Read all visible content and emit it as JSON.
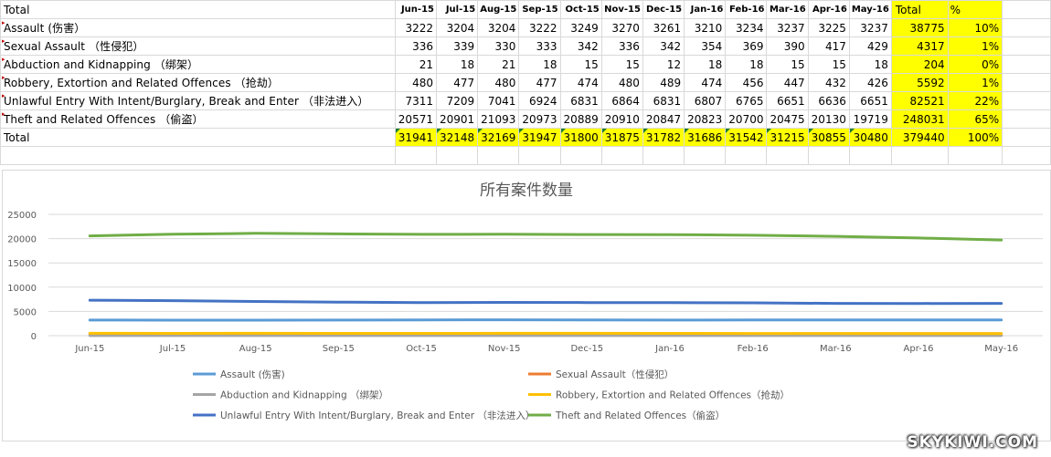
{
  "table": {
    "corner_label": "Total",
    "months": [
      "Jun-15",
      "Jul-15",
      "Aug-15",
      "Sep-15",
      "Oct-15",
      "Nov-15",
      "Dec-15",
      "Jan-16",
      "Feb-16",
      "Mar-16",
      "Apr-16",
      "May-16"
    ],
    "total_header": "Total",
    "pct_header": "%",
    "rows": [
      {
        "label": "Assault (伤害）",
        "values": [
          "3222",
          "3204",
          "3204",
          "3222",
          "3249",
          "3270",
          "3261",
          "3210",
          "3234",
          "3237",
          "3225",
          "3237"
        ],
        "total": "38775",
        "pct": "10%"
      },
      {
        "label": "Sexual Assault （性侵犯）",
        "values": [
          "336",
          "339",
          "330",
          "333",
          "342",
          "336",
          "342",
          "354",
          "369",
          "390",
          "417",
          "429"
        ],
        "total": "4317",
        "pct": "1%"
      },
      {
        "label": "Abduction and Kidnapping （绑架）",
        "values": [
          "21",
          "18",
          "21",
          "18",
          "15",
          "15",
          "12",
          "18",
          "18",
          "15",
          "15",
          "18"
        ],
        "total": "204",
        "pct": "0%"
      },
      {
        "label": "Robbery, Extortion and Related Offences （抢劫）",
        "values": [
          "480",
          "477",
          "480",
          "477",
          "474",
          "480",
          "489",
          "474",
          "456",
          "447",
          "432",
          "426"
        ],
        "total": "5592",
        "pct": "1%"
      },
      {
        "label": "Unlawful Entry With Intent/Burglary, Break and Enter （非法进入）",
        "values": [
          "7311",
          "7209",
          "7041",
          "6924",
          "6831",
          "6864",
          "6831",
          "6807",
          "6765",
          "6651",
          "6636",
          "6651"
        ],
        "total": "82521",
        "pct": "22%"
      },
      {
        "label": "Theft and Related Offences （偷盗）",
        "values": [
          "20571",
          "20901",
          "21093",
          "20973",
          "20889",
          "20910",
          "20847",
          "20823",
          "20700",
          "20475",
          "20130",
          "19719"
        ],
        "total": "248031",
        "pct": "65%"
      }
    ],
    "total_row": {
      "label": "Total",
      "values": [
        "31941",
        "32148",
        "32169",
        "31947",
        "31800",
        "31875",
        "31782",
        "31686",
        "31542",
        "31215",
        "30855",
        "30480"
      ],
      "total": "379440",
      "pct": "100%"
    }
  },
  "chart_data": {
    "type": "line",
    "title": "所有案件数量",
    "categories": [
      "Jun-15",
      "Jul-15",
      "Aug-15",
      "Sep-15",
      "Oct-15",
      "Nov-15",
      "Dec-15",
      "Jan-16",
      "Feb-16",
      "Mar-16",
      "Apr-16",
      "May-16"
    ],
    "ylim": [
      0,
      25000
    ],
    "yticks": [
      "0",
      "5000",
      "10000",
      "15000",
      "20000",
      "25000"
    ],
    "grid": true,
    "legend_position": "bottom",
    "series": [
      {
        "name": "Assault (伤害)",
        "color": "#5b9bd5",
        "values": [
          3222,
          3204,
          3204,
          3222,
          3249,
          3270,
          3261,
          3210,
          3234,
          3237,
          3225,
          3237
        ]
      },
      {
        "name": "Sexual Assault（性侵犯）",
        "color": "#ed7d31",
        "values": [
          336,
          339,
          330,
          333,
          342,
          336,
          342,
          354,
          369,
          390,
          417,
          429
        ]
      },
      {
        "name": "Abduction and Kidnapping （绑架）",
        "color": "#a5a5a5",
        "values": [
          21,
          18,
          21,
          18,
          15,
          15,
          12,
          18,
          18,
          15,
          15,
          18
        ]
      },
      {
        "name": "Robbery, Extortion and Related Offences（抢劫）",
        "color": "#ffc000",
        "values": [
          480,
          477,
          480,
          477,
          474,
          480,
          489,
          474,
          456,
          447,
          432,
          426
        ]
      },
      {
        "name": "Unlawful Entry With Intent/Burglary, Break and Enter （非法进入）",
        "color": "#4472c4",
        "values": [
          7311,
          7209,
          7041,
          6924,
          6831,
          6864,
          6831,
          6807,
          6765,
          6651,
          6636,
          6651
        ]
      },
      {
        "name": "Theft and Related Offences（偷盗）",
        "color": "#70ad47",
        "values": [
          20571,
          20901,
          21093,
          20973,
          20889,
          20910,
          20847,
          20823,
          20700,
          20475,
          20130,
          19719
        ]
      }
    ]
  },
  "watermark": "SKYKIWI.COM"
}
